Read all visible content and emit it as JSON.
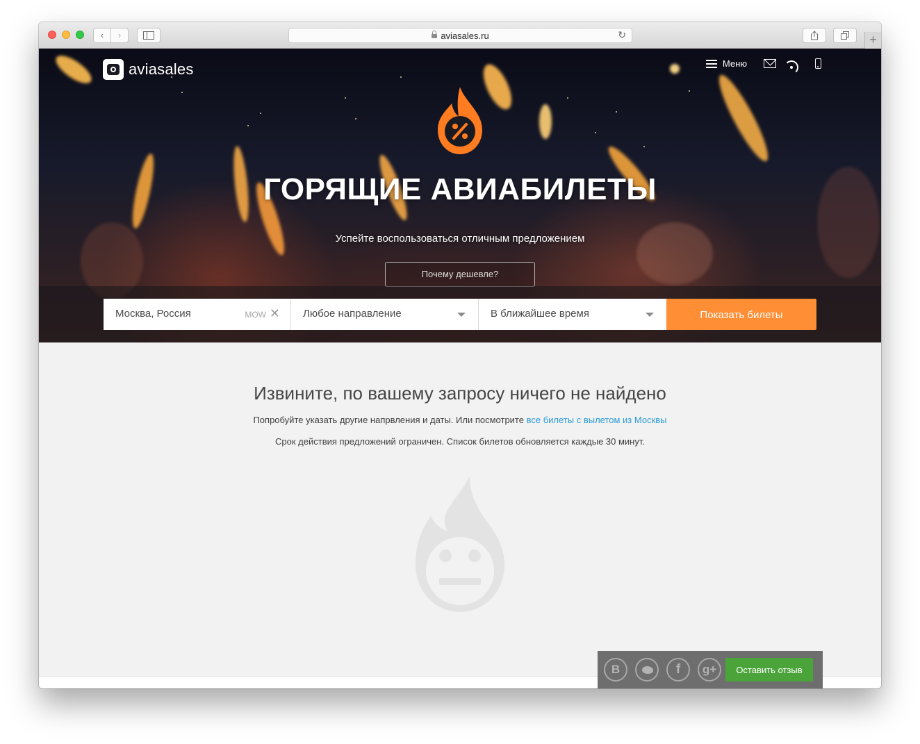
{
  "browser": {
    "url": "aviasales.ru"
  },
  "header": {
    "logo_text": "aviasales",
    "menu_label": "Меню"
  },
  "hero": {
    "title": "ГОРЯЩИЕ АВИАБИЛЕТЫ",
    "subtitle": "Успейте воспользоваться отличным предложением",
    "why_button": "Почему дешевле?"
  },
  "search": {
    "origin": "Москва, Россия",
    "origin_code": "MOW",
    "destination": "Любое направление",
    "date": "В ближайшее время",
    "submit": "Показать билеты"
  },
  "empty_state": {
    "title": "Извините, по вашему запросу ничего не найдено",
    "text": "Попробуйте указать другие напрвления и даты. Или посмотрите",
    "link": "все билеты с вылетом из Москвы",
    "note": "Срок действия предложений ограничен. Список билетов обновляется каждые 30 минут."
  },
  "feedback": {
    "vk": "В",
    "facebook": "f",
    "gplus": "g+",
    "button": "Оставить отзыв"
  },
  "colors": {
    "accent_orange": "#ff8e35",
    "feedback_green": "#4ba43a",
    "link_blue": "#2a9bd6"
  }
}
